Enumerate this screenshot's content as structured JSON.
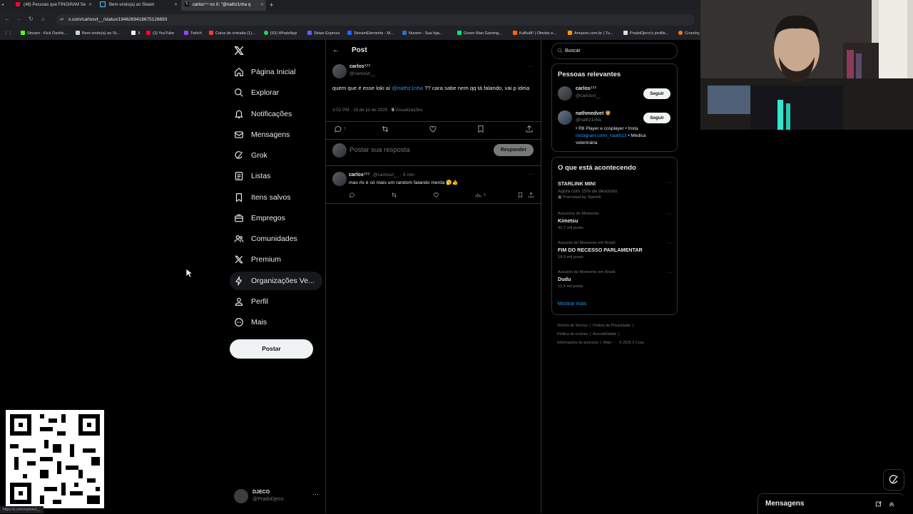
{
  "browser": {
    "tabs": [
      {
        "label": "(48) Pessoas que FINGIRAM Se",
        "color": "#ff0033"
      },
      {
        "label": "Bem-vindo(a) ao Steam",
        "color": "#1b2838"
      },
      {
        "label": "carlos⁷⁷⁷ no X: \"@nathz1nha q",
        "color": "#ffffff"
      }
    ],
    "url": "x.com/carlosvt__/status/1946269418675126693",
    "bookmarks": [
      {
        "label": "Stream - Kick Dashb...",
        "color": "#53fc18"
      },
      {
        "label": "Bem-vindo(a) ao St...",
        "color": "#c7d5e0"
      },
      {
        "label": "X",
        "color": "#ffffff"
      },
      {
        "label": "(3) YouTube",
        "color": "#ff0033"
      },
      {
        "label": "Twitch",
        "color": "#9146ff"
      },
      {
        "label": "Caixa de entrada (1)...",
        "color": "#ea4335"
      },
      {
        "label": "(63) WhatsApp",
        "color": "#25d366"
      },
      {
        "label": "Stripe Express",
        "color": "#635bff"
      },
      {
        "label": "StreamElements - M...",
        "color": "#1f69ff"
      },
      {
        "label": "Nuvem - Sua loja...",
        "color": "#2c6ecb"
      },
      {
        "label": "Green Man Gaming...",
        "color": "#00e676"
      },
      {
        "label": "KaBuM! | Ofertas e...",
        "color": "#ff6500"
      },
      {
        "label": "Amazon.com.br | Tu...",
        "color": "#ff9900"
      },
      {
        "label": "PradoDjeco's profile...",
        "color": "#dddddd"
      },
      {
        "label": "Crunchy",
        "color": "#f47521"
      }
    ],
    "status_url": "https://x.com/carlosvt__"
  },
  "nav": {
    "items": [
      {
        "label": "Página Inicial",
        "icon": "home-icon"
      },
      {
        "label": "Explorar",
        "icon": "search-icon"
      },
      {
        "label": "Notificações",
        "icon": "bell-icon"
      },
      {
        "label": "Mensagens",
        "icon": "mail-icon"
      },
      {
        "label": "Grok",
        "icon": "grok-icon"
      },
      {
        "label": "Listas",
        "icon": "list-icon"
      },
      {
        "label": "Itens salvos",
        "icon": "bookmark-icon"
      },
      {
        "label": "Empregos",
        "icon": "briefcase-icon"
      },
      {
        "label": "Comunidades",
        "icon": "people-icon"
      },
      {
        "label": "Premium",
        "icon": "x-icon"
      },
      {
        "label": "Organizações Ve...",
        "icon": "lightning-icon"
      },
      {
        "label": "Perfil",
        "icon": "person-icon"
      },
      {
        "label": "Mais",
        "icon": "more-circle-icon"
      }
    ],
    "post_button": "Postar",
    "account": {
      "name": "DJECO",
      "handle": "@PradoDjeco"
    }
  },
  "post": {
    "header_title": "Post",
    "author_name": "carlos⁷⁷⁷",
    "author_handle": "@carlosvt__",
    "text_before": "quem que é esse loki aí ",
    "mention": "@nathz1nha",
    "text_after": " ?? cara sabe nem qq tá falando, vai p ideia",
    "time": "3:02 PM · 18 de jul de 2025 · ",
    "views_count": "9",
    "views_label": " Visualizações",
    "reply_count": "1",
    "reply_placeholder": "Postar sua resposta",
    "reply_button": "Responder"
  },
  "comment": {
    "author_name": "carlos⁷⁷⁷",
    "meta": "@carlosvt__ · 6 min",
    "text": "mas rlx é só mais um random falando merda 🥱👍",
    "views_count": "5"
  },
  "sidebar": {
    "search_placeholder": "Buscar",
    "relevant_title": "Pessoas relevantes",
    "people": [
      {
        "name": "carlos⁷⁷⁷",
        "handle": "@carlosvt__",
        "follow": "Seguir",
        "bio_before": "",
        "bio_link": "",
        "bio_after": ""
      },
      {
        "name": "nathmedvet 🦁",
        "handle": "@nathz1nha",
        "follow": "Seguir",
        "bio_before": "• R6 Player e cosplayer • Insta ",
        "bio_link": "instagram.com/_naath13",
        "bio_after": " • Médica veterinária"
      }
    ],
    "trends_title": "O que está acontecendo",
    "trends": [
      {
        "context": "",
        "title": "STARLINK MINI",
        "count": "Agora com 15% de desconto",
        "promo": "Promoted by Starlink"
      },
      {
        "context": "Assuntos do Momento",
        "title": "Kimetsu",
        "count": "42,7 mil posts",
        "promo": ""
      },
      {
        "context": "Assunto do Momento em Brasil",
        "title": "FIM DO RECESSO PARLAMENTAR",
        "count": "18,9 mil posts",
        "promo": ""
      },
      {
        "context": "Assunto do Momento em Brasil",
        "title": "Dudu",
        "count": "11,9 mil posts",
        "promo": ""
      }
    ],
    "show_more": "Mostrar mais",
    "footer": [
      "Termos de Serviço",
      "Política de Privacidade",
      "Política de cookies",
      "Acessibilidade",
      "Informações de anúncios",
      "Mais ···",
      "© 2025 X Corp."
    ]
  },
  "messages_bar": {
    "title": "Mensagens"
  }
}
